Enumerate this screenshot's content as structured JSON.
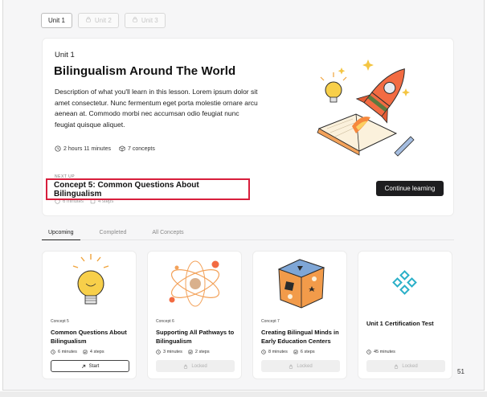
{
  "unit_tabs": [
    {
      "label": "Unit 1",
      "active": true,
      "locked": false
    },
    {
      "label": "Unit 2",
      "active": false,
      "locked": true
    },
    {
      "label": "Unit 3",
      "active": false,
      "locked": true
    }
  ],
  "hero": {
    "unit_label": "Unit 1",
    "title": "Bilingualism Around The World",
    "description": "Description of what you'll learn in this lesson. Lorem ipsum dolor sit amet consectetur. Nunc fermentum eget porta molestie ornare arcu aenean at. Commodo morbi nec accumsan odio feugiat nunc feugiat quisque aliquet.",
    "duration": "2 hours 11 minutes",
    "concepts": "7 concepts",
    "next_up_label": "NEXT UP",
    "next_concept": "Concept 5: Common Questions About Bilingualism",
    "next_minutes": "6 minutes",
    "next_steps": "4 steps",
    "continue_label": "Continue learning",
    "highlight_color": "#d81e3c"
  },
  "tabs": [
    {
      "label": "Upcoming",
      "active": true
    },
    {
      "label": "Completed",
      "active": false
    },
    {
      "label": "All Concepts",
      "active": false
    }
  ],
  "cards": [
    {
      "num": "Concept 5",
      "title": "Common Questions About Bilingualism",
      "minutes": "6 minutes",
      "steps": "4 steps",
      "button": "Start",
      "state": "start"
    },
    {
      "num": "Concept 6",
      "title": "Supporting All Pathways to Bilingualism",
      "minutes": "3 minutes",
      "steps": "2 steps",
      "button": "Locked",
      "state": "locked"
    },
    {
      "num": "Concept 7",
      "title": "Creating Bilingual Minds in Early Education Centers",
      "minutes": "8 minutes",
      "steps": "6 steps",
      "button": "Locked",
      "state": "locked"
    },
    {
      "num": "",
      "title": "Unit 1 Certification Test",
      "minutes": "45 minutes",
      "steps": "",
      "button": "Locked",
      "state": "locked"
    }
  ],
  "page_number": "51",
  "icons": {
    "clock": "clock-icon",
    "concepts": "cube-icon",
    "steps": "checklist-icon",
    "lock": "lock-icon",
    "start": "arrow-up-right-icon"
  }
}
